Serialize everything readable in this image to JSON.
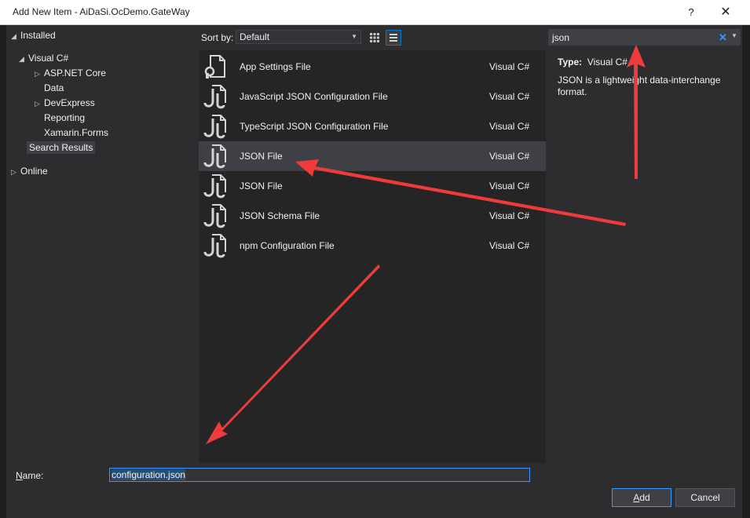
{
  "window": {
    "title": "Add New Item - AiDaSi.OcDemo.GateWay",
    "help_label": "?",
    "close_label": "✕"
  },
  "tree": {
    "installed": "Installed",
    "visual_csharp": "Visual C#",
    "children": [
      {
        "label": "ASP.NET Core",
        "expandable": true
      },
      {
        "label": "Data",
        "expandable": false
      },
      {
        "label": "DevExpress",
        "expandable": true
      },
      {
        "label": "Reporting",
        "expandable": false
      },
      {
        "label": "Xamarin.Forms",
        "expandable": false
      },
      {
        "label": "Search Results",
        "expandable": false,
        "selected": true
      }
    ],
    "online": "Online"
  },
  "sortbar": {
    "label": "Sort by:",
    "selected": "Default"
  },
  "items": [
    {
      "name": "App Settings File",
      "lang": "Visual C#",
      "icon": "settings-file-icon"
    },
    {
      "name": "JavaScript JSON Configuration File",
      "lang": "Visual C#",
      "icon": "json-file-icon"
    },
    {
      "name": "TypeScript JSON Configuration File",
      "lang": "Visual C#",
      "icon": "json-file-icon"
    },
    {
      "name": "JSON File",
      "lang": "Visual C#",
      "icon": "json-file-icon",
      "selected": true
    },
    {
      "name": "JSON File",
      "lang": "Visual C#",
      "icon": "json-file-icon"
    },
    {
      "name": "JSON Schema File",
      "lang": "Visual C#",
      "icon": "json-file-icon"
    },
    {
      "name": "npm Configuration File",
      "lang": "Visual C#",
      "icon": "json-file-icon"
    }
  ],
  "search": {
    "value": "json",
    "clear_label": "✕"
  },
  "detail": {
    "type_label": "Type:",
    "type_value": "Visual C#",
    "description": "JSON is a lightweight data-interchange format."
  },
  "bottom": {
    "name_label_prefix": "N",
    "name_label_rest": "ame:",
    "name_value": "configuration.json",
    "add_prefix": "A",
    "add_rest": "dd",
    "cancel_label": "Cancel"
  },
  "colors": {
    "background": "#2d2d30",
    "list_background": "#252526",
    "selected_row": "#3f3f46",
    "accent": "#3399ff",
    "annotation_arrow": "#ef3b3b"
  }
}
